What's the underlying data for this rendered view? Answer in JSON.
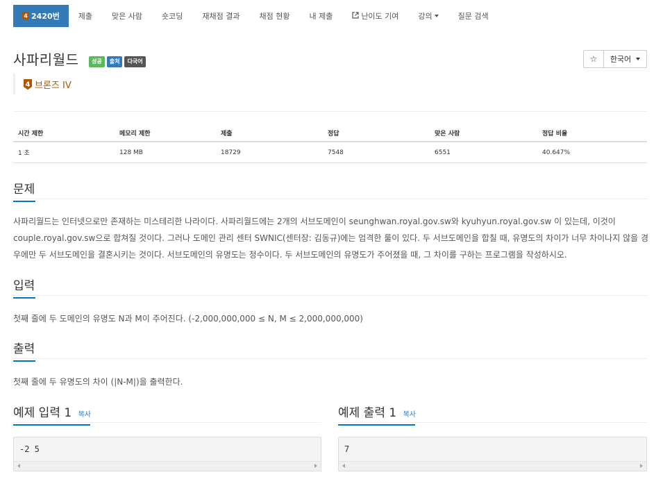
{
  "nav": {
    "tabs": [
      {
        "label": "2420번",
        "tier": "4"
      },
      {
        "label": "제출"
      },
      {
        "label": "맞은 사람"
      },
      {
        "label": "숏코딩"
      },
      {
        "label": "재채점 결과"
      },
      {
        "label": "채점 현황"
      },
      {
        "label": "내 제출"
      },
      {
        "label": "난이도 기여"
      },
      {
        "label": "강의"
      },
      {
        "label": "질문 검색"
      }
    ]
  },
  "problem": {
    "title": "사파리월드",
    "labels": [
      "성공",
      "출처",
      "다국어"
    ],
    "tier_number": "4",
    "tier_name": "브론즈 IV"
  },
  "actions": {
    "star": "☆",
    "language": "한국어"
  },
  "info_table": {
    "headers": [
      "시간 제한",
      "메모리 제한",
      "제출",
      "정답",
      "맞은 사람",
      "정답 비율"
    ],
    "values": [
      "1 초",
      "128 MB",
      "18729",
      "7548",
      "6551",
      "40.647%"
    ]
  },
  "sections": {
    "problem_title": "문제",
    "problem_text": "사파리월드는 인터넷으로만 존재하는 미스테리한 나라이다. 사파리월드에는 2개의 서브도메인이 seunghwan.royal.gov.sw와 kyuhyun.royal.gov.sw 이 있는데, 이것이 couple.royal.gov.sw으로 합쳐질 것이다. 그러나 도메인 관리 센터 SWNIC(센터장: 김동규)에는 엄격한 룰이 있다. 두 서브도메인을 합칠 때, 유명도의 차이가 너무 차이나지 않을 경우에만 두 서브도메인을 결혼시키는 것이다. 서브도메인의 유명도는 정수이다. 두 서브도메인의 유명도가 주어졌을 때, 그 차이를 구하는 프로그램을 작성하시오.",
    "input_title": "입력",
    "input_text": "첫째 줄에 두 도메인의 유명도 N과 M이 주어진다. (-2,000,000,000 ≤ N, M ≤ 2,000,000,000)",
    "output_title": "출력",
    "output_text": "첫째 줄에 두 유명도의 차이 (|N-M|)을 출력한다.",
    "sample_input_title": "예제 입력 1",
    "sample_output_title": "예제 출력 1",
    "copy_label": "복사",
    "sample_input": "-2 5",
    "sample_output": "7"
  },
  "colors": {
    "primary": "#337ab7",
    "success": "#5cb85c",
    "bronze": "#ad5600"
  }
}
